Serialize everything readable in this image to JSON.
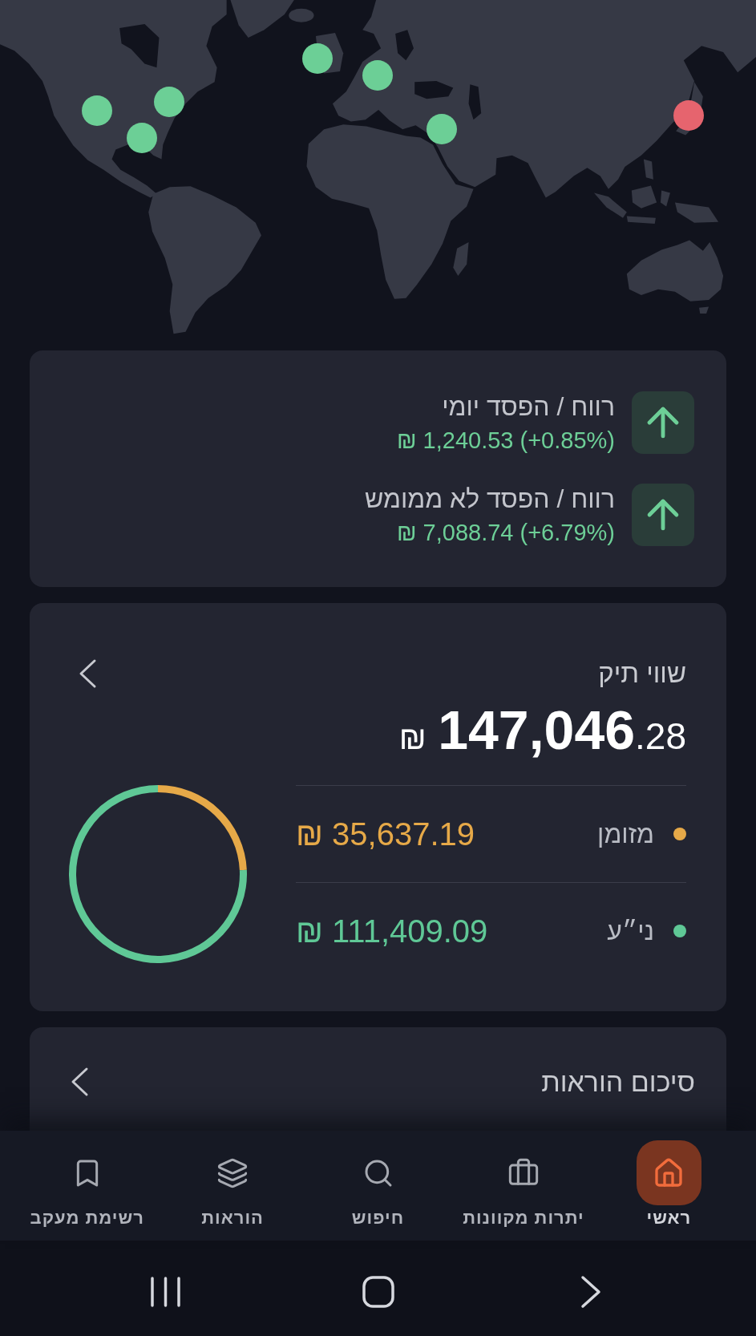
{
  "map": {
    "markers": [
      {
        "color": "#6ccf96"
      },
      {
        "color": "#6ccf96"
      },
      {
        "color": "#6ccf96"
      },
      {
        "color": "#6ccf96"
      },
      {
        "color": "#6ccf96"
      },
      {
        "color": "#6ccf96"
      },
      {
        "color": "#e6646e"
      }
    ]
  },
  "pnl": [
    {
      "title": "רווח / הפסד יומי",
      "value": "₪ 1,240.53 (+0.85%)",
      "gain": true
    },
    {
      "title": "רווח / הפסד לא ממומש",
      "value": "₪ 7,088.74 (+6.79%)",
      "gain": true
    }
  ],
  "portfolio": {
    "title": "שווי תיק",
    "total": {
      "currency": "₪",
      "amount": "147,046",
      "fraction": ".28"
    },
    "chart_data": {
      "type": "donut",
      "categories": [
        "מזומן",
        "ני״ע"
      ],
      "values": [
        24.24,
        75.76
      ]
    },
    "legend": [
      {
        "amount": "₪ 35,637.19",
        "color": "#e6a948"
      },
      {
        "amount": "₪ 111,409.09",
        "color": "#5fc896"
      }
    ]
  },
  "orders_summary": {
    "title": "סיכום הוראות"
  },
  "nav": {
    "items": [
      {
        "label": "ראשי",
        "selected": true
      },
      {
        "label": "יתרות מקוונות",
        "selected": false
      },
      {
        "label": "חיפוש",
        "selected": false
      },
      {
        "label": "הוראות",
        "selected": false
      },
      {
        "label": "רשימת מעקב",
        "selected": false
      }
    ]
  }
}
